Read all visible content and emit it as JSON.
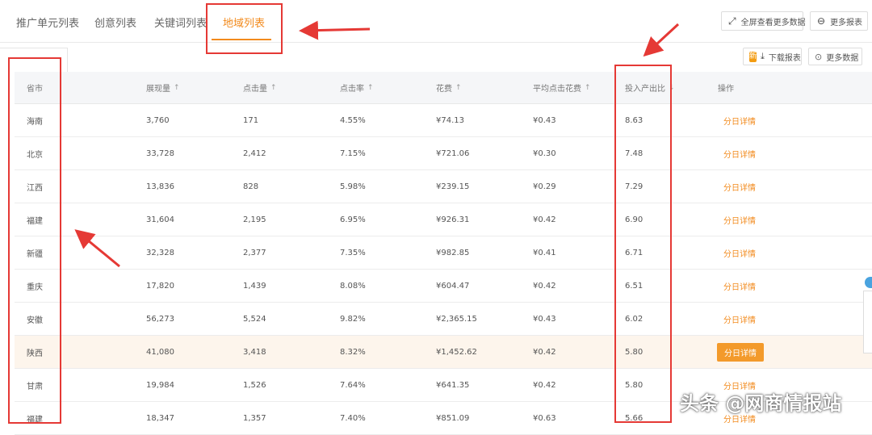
{
  "tabs": [
    {
      "label": "推广单元列表",
      "active": false
    },
    {
      "label": "创意列表",
      "active": false
    },
    {
      "label": "关键词列表",
      "active": false
    },
    {
      "label": "地域列表",
      "active": true
    }
  ],
  "toolbar": {
    "fullscreen_label": "全屏查看更多数据",
    "more_reports_label": "更多报表",
    "new_badge": "新",
    "download_label": "下载报表",
    "more_data_label": "更多数据"
  },
  "table": {
    "headers": {
      "province": "省市",
      "impressions": "展现量",
      "clicks": "点击量",
      "ctr": "点击率",
      "cost": "花费",
      "avg_cpc": "平均点击花费",
      "roi": "投入产出比",
      "action": "操作"
    },
    "sort_icons": {
      "up": "↑",
      "down": "↓"
    },
    "rows": [
      {
        "province": "海南",
        "impressions": "3,760",
        "clicks": "171",
        "ctr": "4.55%",
        "cost": "¥74.13",
        "avg_cpc": "¥0.43",
        "roi": "8.63",
        "action": "分日详情",
        "highlight": false
      },
      {
        "province": "北京",
        "impressions": "33,728",
        "clicks": "2,412",
        "ctr": "7.15%",
        "cost": "¥721.06",
        "avg_cpc": "¥0.30",
        "roi": "7.48",
        "action": "分日详情",
        "highlight": false
      },
      {
        "province": "江西",
        "impressions": "13,836",
        "clicks": "828",
        "ctr": "5.98%",
        "cost": "¥239.15",
        "avg_cpc": "¥0.29",
        "roi": "7.29",
        "action": "分日详情",
        "highlight": false
      },
      {
        "province": "福建",
        "impressions": "31,604",
        "clicks": "2,195",
        "ctr": "6.95%",
        "cost": "¥926.31",
        "avg_cpc": "¥0.42",
        "roi": "6.90",
        "action": "分日详情",
        "highlight": false
      },
      {
        "province": "新疆",
        "impressions": "32,328",
        "clicks": "2,377",
        "ctr": "7.35%",
        "cost": "¥982.85",
        "avg_cpc": "¥0.41",
        "roi": "6.71",
        "action": "分日详情",
        "highlight": false
      },
      {
        "province": "重庆",
        "impressions": "17,820",
        "clicks": "1,439",
        "ctr": "8.08%",
        "cost": "¥604.47",
        "avg_cpc": "¥0.42",
        "roi": "6.51",
        "action": "分日详情",
        "highlight": false
      },
      {
        "province": "安徽",
        "impressions": "56,273",
        "clicks": "5,524",
        "ctr": "9.82%",
        "cost": "¥2,365.15",
        "avg_cpc": "¥0.43",
        "roi": "6.02",
        "action": "分日详情",
        "highlight": false
      },
      {
        "province": "陕西",
        "impressions": "41,080",
        "clicks": "3,418",
        "ctr": "8.32%",
        "cost": "¥1,452.62",
        "avg_cpc": "¥0.42",
        "roi": "5.80",
        "action": "分日详情",
        "highlight": true
      },
      {
        "province": "甘肃",
        "impressions": "19,984",
        "clicks": "1,526",
        "ctr": "7.64%",
        "cost": "¥641.35",
        "avg_cpc": "¥0.42",
        "roi": "5.80",
        "action": "分日详情",
        "highlight": false
      },
      {
        "province": "福建",
        "impressions": "18,347",
        "clicks": "1,357",
        "ctr": "7.40%",
        "cost": "¥851.09",
        "avg_cpc": "¥0.63",
        "roi": "5.66",
        "action": "分日详情",
        "highlight": false
      }
    ]
  },
  "watermark": "头条 @网商情报站",
  "colors": {
    "accent": "#f28a1c",
    "annotation_red": "#e53935",
    "header_bg": "#f5f6f8",
    "highlight_row": "#fdf5ec"
  }
}
